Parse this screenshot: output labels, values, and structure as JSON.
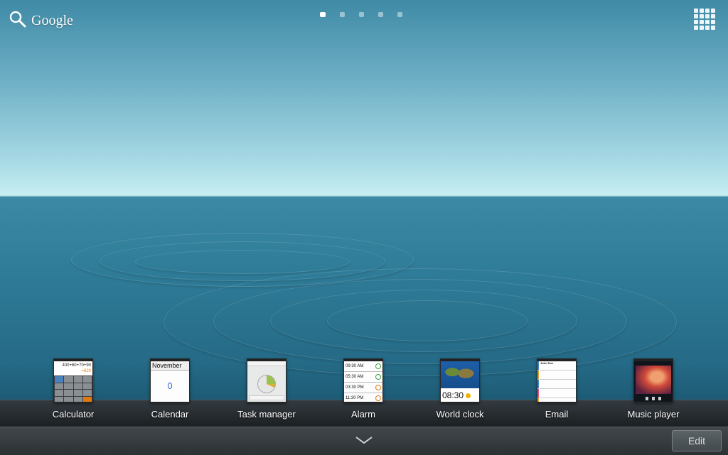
{
  "top_bar": {
    "search_label": "Google",
    "page_count": 5,
    "active_page": 1
  },
  "dock": {
    "apps": [
      {
        "label": "Calculator",
        "thumb": {
          "expr": "400+60+70+90",
          "result": "=620"
        }
      },
      {
        "label": "Calendar",
        "thumb": {
          "month": "November"
        }
      },
      {
        "label": "Task manager"
      },
      {
        "label": "Alarm",
        "thumb": {
          "times": [
            "09:30 AM",
            "05:30 AM",
            "03:30 PM",
            "11:30 PM"
          ]
        }
      },
      {
        "label": "World clock",
        "thumb": {
          "time": "08:30"
        }
      },
      {
        "label": "Email",
        "thumb": {
          "sender": "John Doe"
        }
      },
      {
        "label": "Music player"
      }
    ]
  },
  "bottom_bar": {
    "edit_label": "Edit"
  },
  "colors": {
    "sky": "#a9dbe6",
    "water": "#2f7c98",
    "dock": "#2a2f33"
  }
}
